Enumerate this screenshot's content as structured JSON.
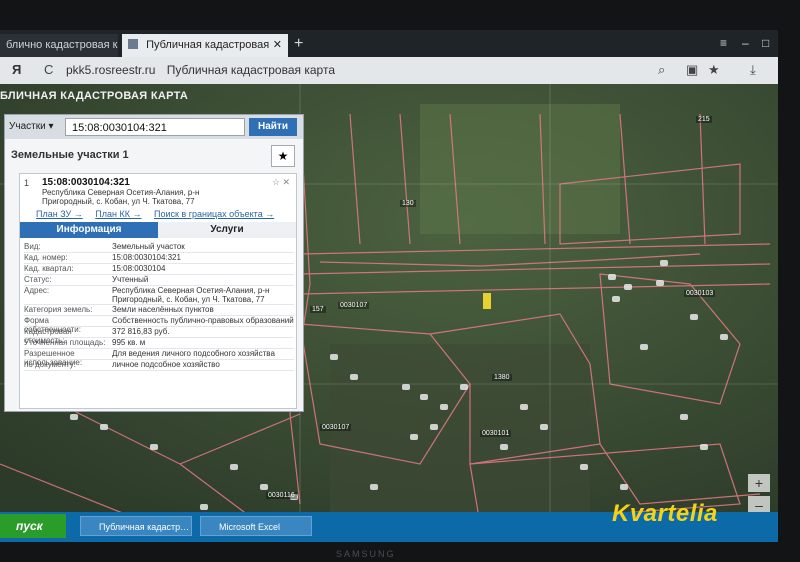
{
  "browser": {
    "tabs": [
      {
        "label": "блично кадастровая ка…",
        "active": false
      },
      {
        "label": "Публичная кадастровая",
        "active": true
      }
    ],
    "new_tab": "+",
    "window_controls": [
      "≡",
      "–",
      "□",
      "✕"
    ],
    "yandex": "Я",
    "reload": "C",
    "url": "pkk5.rosreestr.ru",
    "page_title": "Публичная кадастровая карта"
  },
  "site": {
    "title": "БЛИЧНАЯ КАДАСТРОВАЯ КАРТА",
    "search": {
      "type_label": "Участки ▾",
      "query": "15:08:0030104:321",
      "button": "Найти"
    },
    "results_header": "Земельные участки 1",
    "card": {
      "index": "1",
      "cadastral_number": "15:08:0030104:321",
      "address_short": "Республика Северная Осетия-Алания, р-н Пригородный, с. Кобан, ул Ч. Ткатова, 77",
      "links": [
        "План ЗУ →",
        "План КК →",
        "Поиск в границах объекта →"
      ],
      "tabs": [
        "Информация",
        "Услуги"
      ],
      "rows": [
        {
          "k": "Вид:",
          "v": "Земельный участок"
        },
        {
          "k": "Кад. номер:",
          "v": "15:08:0030104:321"
        },
        {
          "k": "Кад. квартал:",
          "v": "15:08:0030104"
        },
        {
          "k": "Статус:",
          "v": "Учтенный"
        },
        {
          "k": "Адрес:",
          "v": "Республика Северная Осетия-Алания, р-н Пригородный, с. Кобан, ул Ч. Ткатова, 77"
        },
        {
          "k": "Категория земель:",
          "v": "Земли населённых пунктов"
        },
        {
          "k": "Форма собственности:",
          "v": "Собственность публично-правовых образований"
        },
        {
          "k": "Кадастровая стоимость:",
          "v": "372 816,83 руб."
        },
        {
          "k": "Уточненная площадь:",
          "v": "995 кв. м"
        },
        {
          "k": "Разрешенное использование:",
          "v": "Для ведения личного подсобного хозяйства"
        },
        {
          "k": "по документу:",
          "v": "личное подсобное хозяйство"
        }
      ]
    },
    "zoom": [
      "+",
      "–"
    ],
    "map_labels": [
      "130",
      "215",
      "157",
      "1380",
      "0030107",
      "0030107",
      "0030103",
      "0030101",
      "0030116"
    ]
  },
  "taskbar": {
    "start": "пуск",
    "items": [
      "Публичная кадастр…",
      "Microsoft Excel"
    ]
  },
  "brand": "Kvartelia",
  "monitor_brand": "SAMSUNG",
  "colors": {
    "accent": "#2e6fb6",
    "parcel_border": "#e67a86",
    "map_bg": "#3b4a36",
    "taskbar": "#0d6aa9",
    "brand": "#f5d21a"
  }
}
